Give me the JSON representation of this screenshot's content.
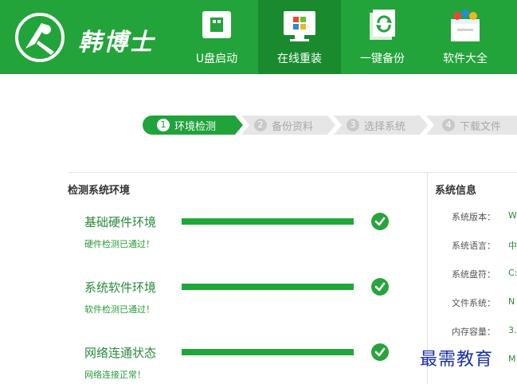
{
  "brand": {
    "name": "韩博士"
  },
  "nav": {
    "items": [
      {
        "label": "U盘启动",
        "icon": "usb-drive-icon"
      },
      {
        "label": "在线重装",
        "icon": "windows-monitor-icon"
      },
      {
        "label": "一键备份",
        "icon": "backup-refresh-icon"
      },
      {
        "label": "软件大全",
        "icon": "software-box-icon"
      }
    ],
    "active_index": 1
  },
  "steps": [
    {
      "num": "1",
      "label": "环境检测",
      "state": "active"
    },
    {
      "num": "2",
      "label": "备份资料",
      "state": "inactive"
    },
    {
      "num": "3",
      "label": "选择系统",
      "state": "inactive"
    },
    {
      "num": "4",
      "label": "下载文件",
      "state": "inactive"
    }
  ],
  "checks": {
    "title": "检测系统环境",
    "items": [
      {
        "title": "基础硬件环境",
        "status": "硬件检测已通过！",
        "progress": 1.0,
        "passed": true
      },
      {
        "title": "系统软件环境",
        "status": "软件检测已通过！",
        "progress": 1.0,
        "passed": true
      },
      {
        "title": "网络连通状态",
        "status": "网络连接正常！",
        "progress": 1.0,
        "passed": true
      }
    ]
  },
  "sysinfo": {
    "title": "系统信息",
    "rows": [
      {
        "label": "系统版本：",
        "value": "W"
      },
      {
        "label": "系统语言：",
        "value": "中"
      },
      {
        "label": "系统盘符：",
        "value": "C:"
      },
      {
        "label": "文件系统：",
        "value": "N"
      },
      {
        "label": "内存容量：",
        "value": "3."
      },
      {
        "label": "",
        "value": "M"
      }
    ]
  },
  "watermark": "最需教育",
  "colors": {
    "brand_green": "#22a43a",
    "active_nav": "#1a8a2f",
    "step_active": "#1fa33a",
    "step_inactive": "#e6e6e6"
  }
}
